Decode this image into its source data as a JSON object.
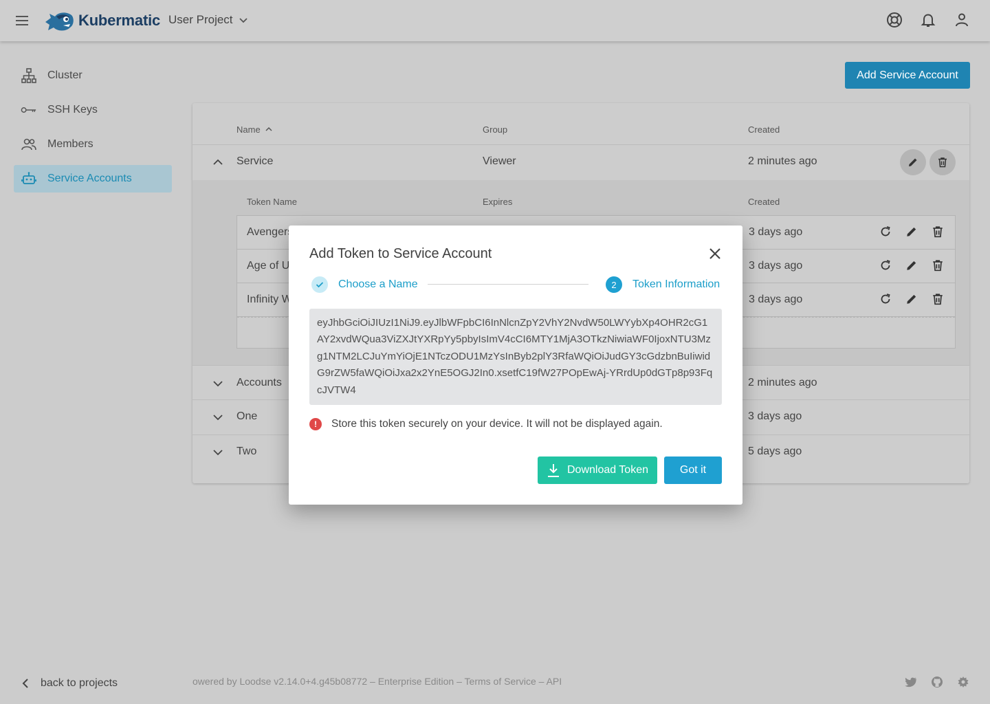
{
  "app": {
    "brand": "Kubermatic",
    "project": "User Project"
  },
  "sidebar": {
    "items": [
      {
        "label": "Cluster",
        "icon": "cluster-icon"
      },
      {
        "label": "SSH Keys",
        "icon": "key-icon"
      },
      {
        "label": "Members",
        "icon": "members-icon"
      },
      {
        "label": "Service Accounts",
        "icon": "robot-icon",
        "active": true
      }
    ],
    "back_label": "back to projects"
  },
  "main": {
    "add_button": "Add Service Account",
    "headers": {
      "name": "Name",
      "group": "Group",
      "created": "Created"
    },
    "accounts": [
      {
        "name": "Service",
        "group": "Viewer",
        "created": "2 minutes ago",
        "expanded": true
      },
      {
        "name": "Accounts",
        "created": "2 minutes ago"
      },
      {
        "name": "One",
        "created": "3 days ago"
      },
      {
        "name": "Two",
        "created": "5 days ago"
      }
    ],
    "token_headers": {
      "name": "Token Name",
      "expires": "Expires",
      "created": "Created"
    },
    "tokens": [
      {
        "name": "Avengers",
        "created": "3 days ago"
      },
      {
        "name": "Age of U",
        "created": "3 days ago"
      },
      {
        "name": "Infinity W",
        "created": "3 days ago"
      }
    ]
  },
  "footer": {
    "text": "owered by Loodse v2.14.0+4.g45b08772 – Enterprise Edition – Terms of Service – API"
  },
  "dialog": {
    "title": "Add Token to Service Account",
    "step1_label": "Choose a Name",
    "step2_num": "2",
    "step2_label": "Token Information",
    "token": "eyJhbGciOiJIUzI1NiJ9.eyJlbWFpbCI6InNlcnZpY2VhY2NvdW50LWYybXp4OHR2cG1AY2xvdWQua3ViZXJtYXRpYy5pbyIsImV4cCI6MTY1MjA3OTkzNiwiaWF0IjoxNTU3Mzg1NTM2LCJuYmYiOjE1NTczODU1MzYsInByb2plY3RfaWQiOiJudGY3cGdzbnBuIiwidG9rZW5faWQiOiJxa2x2YnE5OGJ2In0.xsetfC19fW27POpEwAj-YRrdUp0dGTp8p93FqcJVTW4",
    "warning": "Store this token securely on your device. It will not be displayed again.",
    "download_label": "Download Token",
    "got_label": "Got it"
  },
  "colors": {
    "accent": "#1fa0d1",
    "download": "#22c4a3",
    "brand": "#1c3e63",
    "warning": "#e04848"
  }
}
